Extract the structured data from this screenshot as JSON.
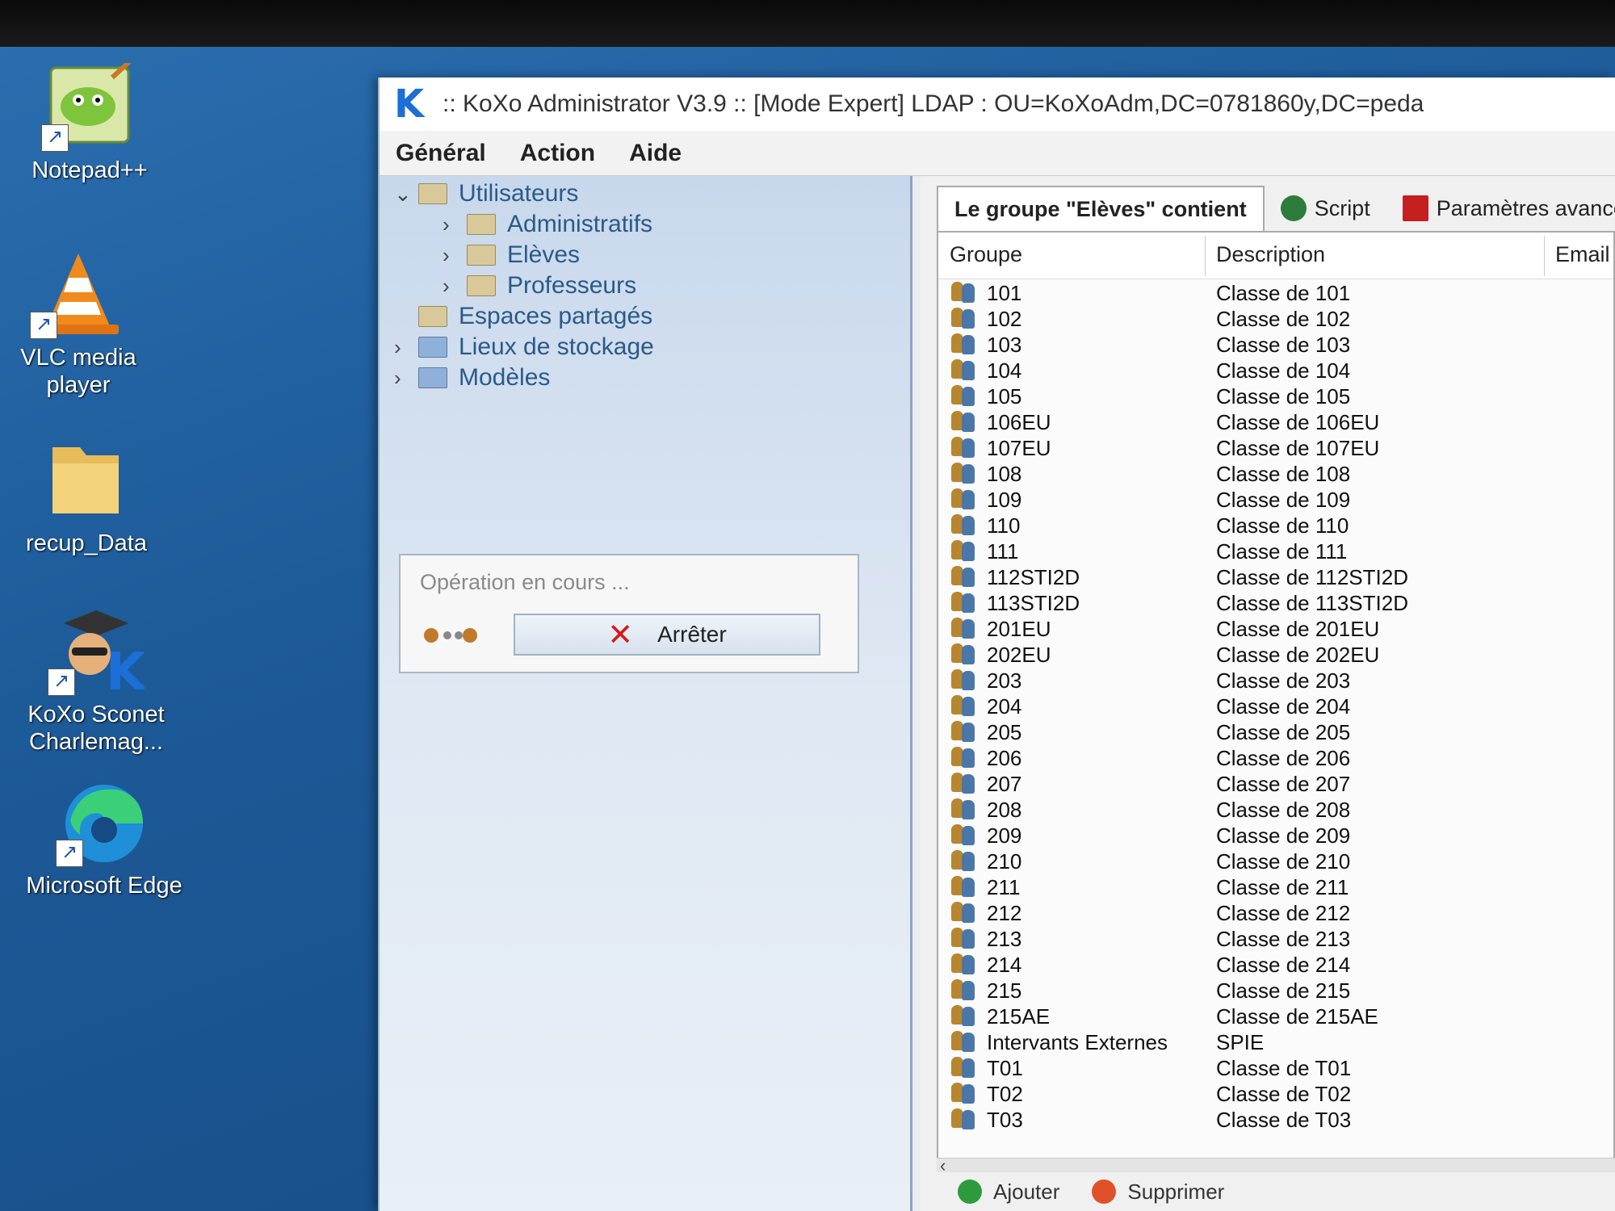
{
  "desktop": {
    "icons": [
      {
        "label": "Notepad++",
        "icon": "notepad-plus-plus-icon"
      },
      {
        "label": "VLC media player",
        "icon": "vlc-cone-icon"
      },
      {
        "label": "recup_Data",
        "icon": "folder-icon"
      },
      {
        "label": "KoXo Sconet Charlemag...",
        "icon": "koxo-sconet-icon"
      },
      {
        "label": "Microsoft Edge",
        "icon": "edge-icon"
      }
    ]
  },
  "window": {
    "logo": "K",
    "title": ":: KoXo Administrator V3.9 :: [Mode Expert] LDAP : OU=KoXoAdm,DC=0781860y,DC=peda",
    "menu": [
      "Général",
      "Action",
      "Aide"
    ]
  },
  "tree": {
    "items": [
      {
        "label": "Utilisateurs",
        "arrow": "⌄"
      },
      {
        "label": "Administratifs",
        "arrow": "›"
      },
      {
        "label": "Elèves",
        "arrow": "›"
      },
      {
        "label": "Professeurs",
        "arrow": "›"
      },
      {
        "label": "Espaces partagés",
        "arrow": ""
      },
      {
        "label": "Lieux de stockage",
        "arrow": "›"
      },
      {
        "label": "Modèles",
        "arrow": "›"
      }
    ]
  },
  "operation": {
    "title": "Opération en cours ...",
    "stop_label": "Arrêter"
  },
  "tabs": [
    {
      "label": "Le groupe \"Elèves\" contient"
    },
    {
      "label": "Script"
    },
    {
      "label": "Paramètres avancés"
    }
  ],
  "table": {
    "headers": {
      "group": "Groupe",
      "description": "Description",
      "email": "Email"
    },
    "rows": [
      {
        "name": "101",
        "desc": "Classe de 101"
      },
      {
        "name": "102",
        "desc": "Classe de 102"
      },
      {
        "name": "103",
        "desc": "Classe de 103"
      },
      {
        "name": "104",
        "desc": "Classe de 104"
      },
      {
        "name": "105",
        "desc": "Classe de 105"
      },
      {
        "name": "106EU",
        "desc": "Classe de 106EU"
      },
      {
        "name": "107EU",
        "desc": "Classe de 107EU"
      },
      {
        "name": "108",
        "desc": "Classe de 108"
      },
      {
        "name": "109",
        "desc": "Classe de 109"
      },
      {
        "name": "110",
        "desc": "Classe de 110"
      },
      {
        "name": "111",
        "desc": "Classe de 111"
      },
      {
        "name": "112STI2D",
        "desc": "Classe de 112STI2D"
      },
      {
        "name": "113STI2D",
        "desc": "Classe de 113STI2D"
      },
      {
        "name": "201EU",
        "desc": "Classe de 201EU"
      },
      {
        "name": "202EU",
        "desc": "Classe de 202EU"
      },
      {
        "name": "203",
        "desc": "Classe de 203"
      },
      {
        "name": "204",
        "desc": "Classe de 204"
      },
      {
        "name": "205",
        "desc": "Classe de 205"
      },
      {
        "name": "206",
        "desc": "Classe de 206"
      },
      {
        "name": "207",
        "desc": "Classe de 207"
      },
      {
        "name": "208",
        "desc": "Classe de 208"
      },
      {
        "name": "209",
        "desc": "Classe de 209"
      },
      {
        "name": "210",
        "desc": "Classe de 210"
      },
      {
        "name": "211",
        "desc": "Classe de 211"
      },
      {
        "name": "212",
        "desc": "Classe de 212"
      },
      {
        "name": "213",
        "desc": "Classe de 213"
      },
      {
        "name": "214",
        "desc": "Classe de 214"
      },
      {
        "name": "215",
        "desc": "Classe de 215"
      },
      {
        "name": "215AE",
        "desc": "Classe de 215AE"
      },
      {
        "name": "Intervants Externes",
        "desc": "SPIE"
      },
      {
        "name": "T01",
        "desc": "Classe de T01"
      },
      {
        "name": "T02",
        "desc": "Classe de T02"
      },
      {
        "name": "T03",
        "desc": "Classe de T03"
      }
    ]
  },
  "footer": {
    "add_label": "Ajouter",
    "delete_label": "Supprimer"
  },
  "colors": {
    "desktop_blue": "#1d5a98",
    "logo_blue": "#1b6fd6",
    "stop_red": "#d41a1a"
  }
}
